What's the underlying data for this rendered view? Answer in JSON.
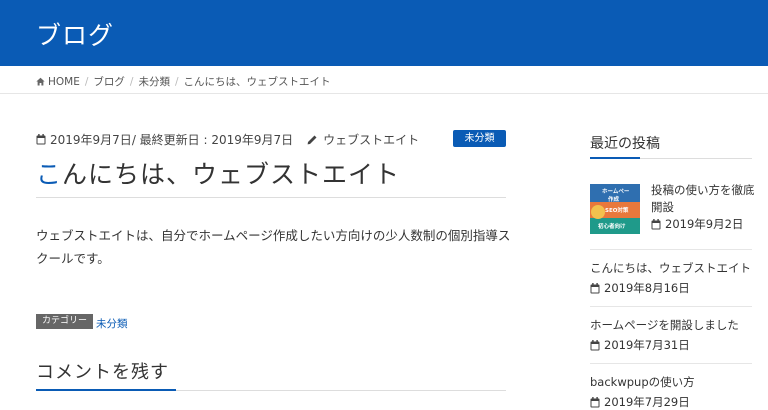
{
  "header": {
    "site_title": "ブログ"
  },
  "breadcrumb": {
    "home": "HOME",
    "separator": "/",
    "items": [
      "ブログ",
      "未分類",
      "こんにちは、ウェブストエイト"
    ]
  },
  "post": {
    "meta": {
      "published": "2019年9月7日",
      "updated_prefix": "/ 最終更新日 : ",
      "updated": "2019年9月7日",
      "author": "ウェブストエイト"
    },
    "category_badge": "未分類",
    "title_first": "こ",
    "title_rest": "んにちは、ウェブストエイト",
    "body": "ウェブストエイトは、自分でホームページ作成したい方向けの少人数制の個別指導スクールです。",
    "category_label": "カテゴリー",
    "category_link": "未分類"
  },
  "comments": {
    "title": "コメントを残す"
  },
  "sidebar": {
    "title": "最近の投稿",
    "thumb_text": [
      "ホームペー",
      "作成",
      "SEO対策",
      "初心者向け"
    ],
    "posts": [
      {
        "title": "投稿の使い方を徹底開設",
        "date": "2019年9月2日"
      },
      {
        "title": "こんにちは、ウェブストエイト",
        "date": "2019年8月16日"
      },
      {
        "title": "ホームページを開設しました",
        "date": "2019年7月31日"
      },
      {
        "title": "backwpupの使い方",
        "date": "2019年7月29日"
      }
    ]
  },
  "colors": {
    "brand": "#0a5bb5",
    "text": "#333333",
    "badge_gray": "#666666"
  },
  "icons": [
    "home-icon",
    "calendar-icon",
    "pencil-icon"
  ]
}
